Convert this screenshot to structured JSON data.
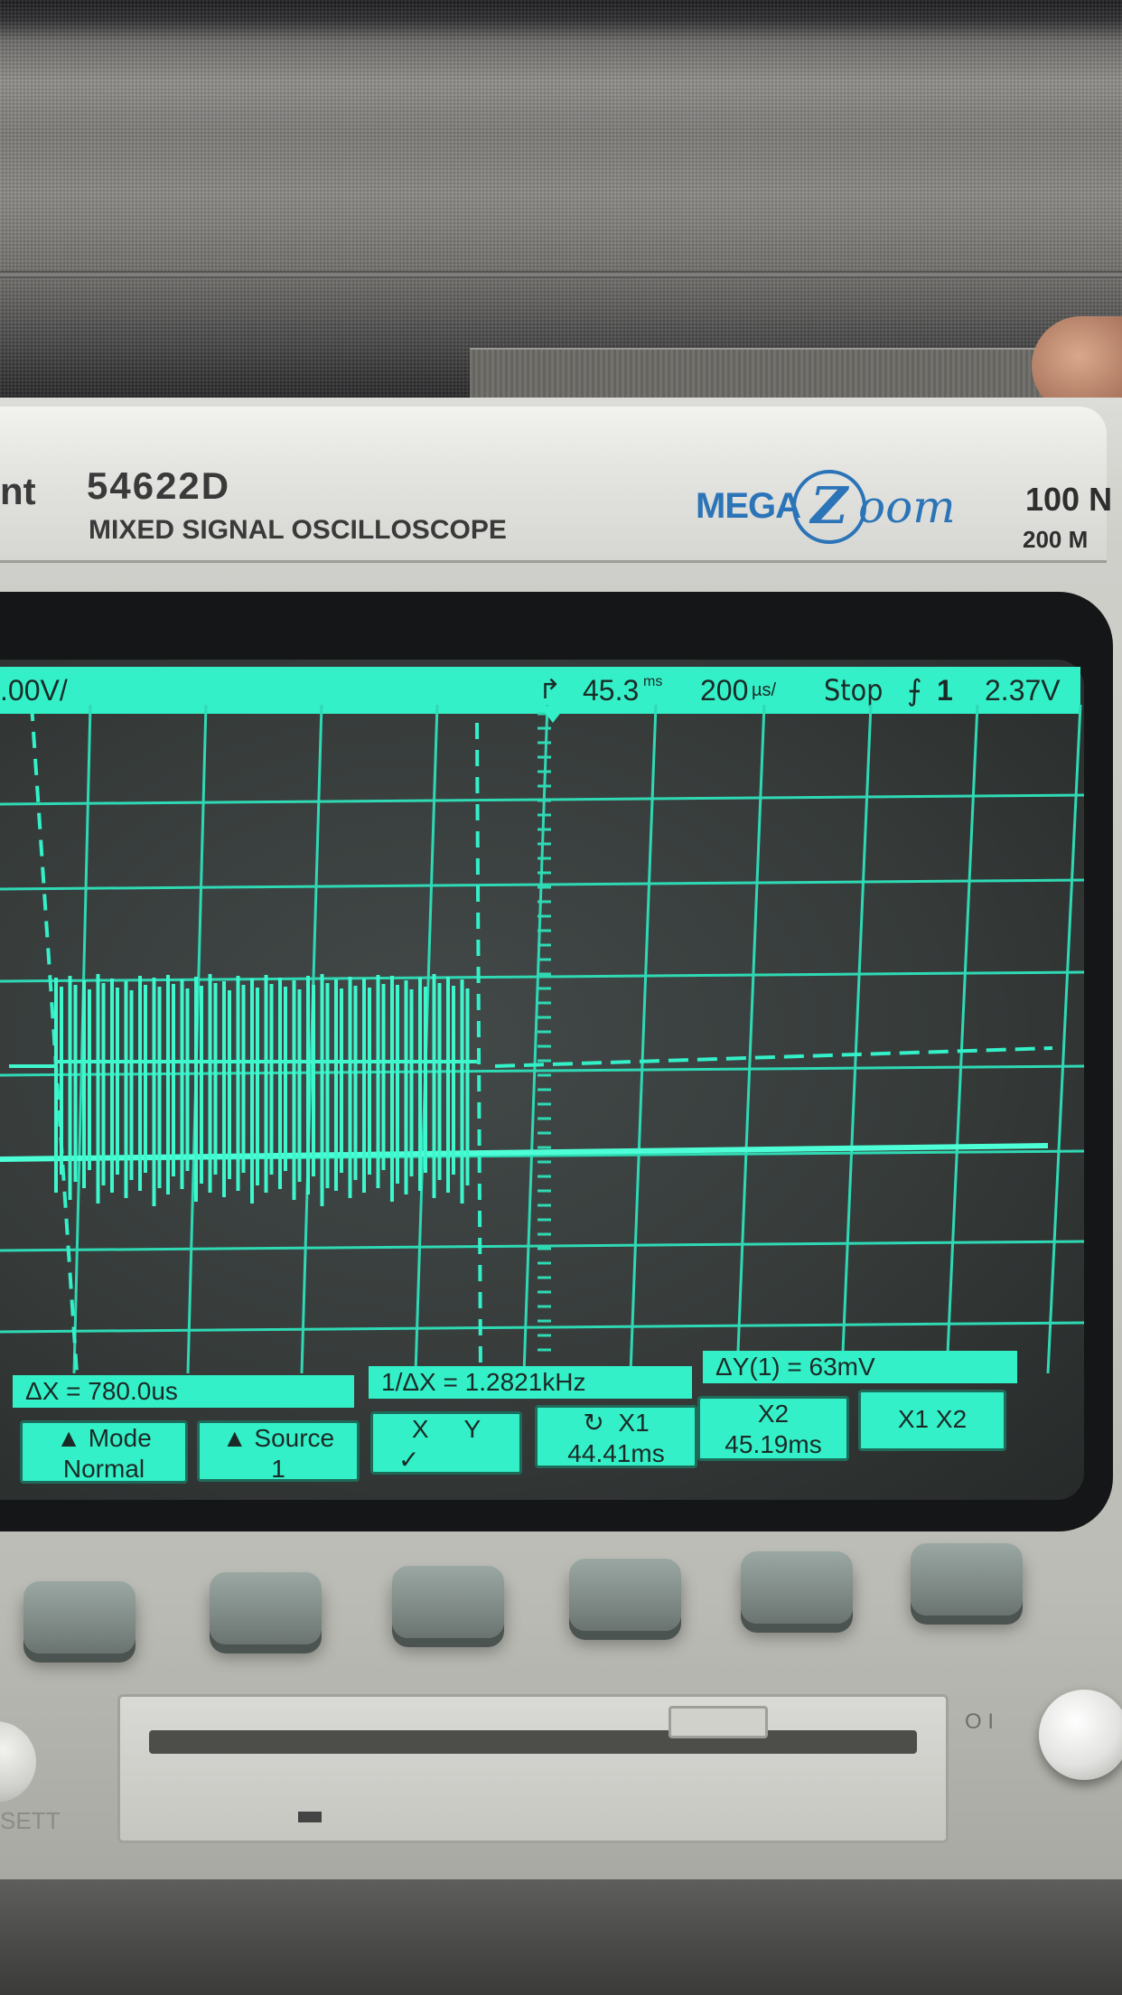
{
  "instrument": {
    "brand_fragment": "nt",
    "model_number": "54622D",
    "model_description": "MIXED SIGNAL OSCILLOSCOPE",
    "logo": {
      "mega": "MEGA",
      "z": "Z",
      "oom": "oom"
    },
    "spec_line1": "100 N",
    "spec_line2": "200 M",
    "bottom_label": "SETT"
  },
  "status_bar": {
    "channel_scale": ".00V/",
    "trigger_marker": "↱",
    "delay": "45.3",
    "delay_unit": "ms",
    "timebase": "200",
    "timebase_unit": "µs/",
    "run_state": "Stop",
    "trigger_slope": "⨍",
    "trigger_source": "1",
    "trigger_level": "2.37V"
  },
  "measurements": {
    "delta_x": "ΔX  =  780.0us",
    "inverse_delta_x": "1/ΔX  =  1.2821kHz",
    "delta_y": "ΔY(1)  =  63mV"
  },
  "softkeys": {
    "mode": {
      "label": "Mode",
      "value": "Normal"
    },
    "source": {
      "label": "Source",
      "value": "1"
    },
    "xy": {
      "x": "X",
      "y": "Y",
      "check": "✓"
    },
    "x1": {
      "label": "X1",
      "value": "44.41ms"
    },
    "x2": {
      "label": "X2",
      "value": "45.19ms"
    },
    "x1x2": {
      "label": "X1  X2"
    }
  },
  "power_symbols": "O I",
  "colors": {
    "phosphor": "#33f0c8",
    "screen": "#363b3a",
    "logo_blue": "#2b74b8"
  },
  "icons": [
    "arrow-up-icon",
    "rotate-knob-icon",
    "check-icon",
    "trigger-slope-icon"
  ],
  "chart_data": {
    "type": "line",
    "series": [
      {
        "values": [
          0,
          0,
          1,
          1,
          1,
          1,
          1,
          1,
          0,
          0,
          0,
          0,
          0,
          0,
          0,
          0
        ]
      }
    ],
    "x": [
      0,
      1,
      2,
      3,
      4,
      5,
      6,
      7,
      8,
      9,
      10,
      11,
      12,
      13,
      14,
      15
    ],
    "grid": true
  }
}
